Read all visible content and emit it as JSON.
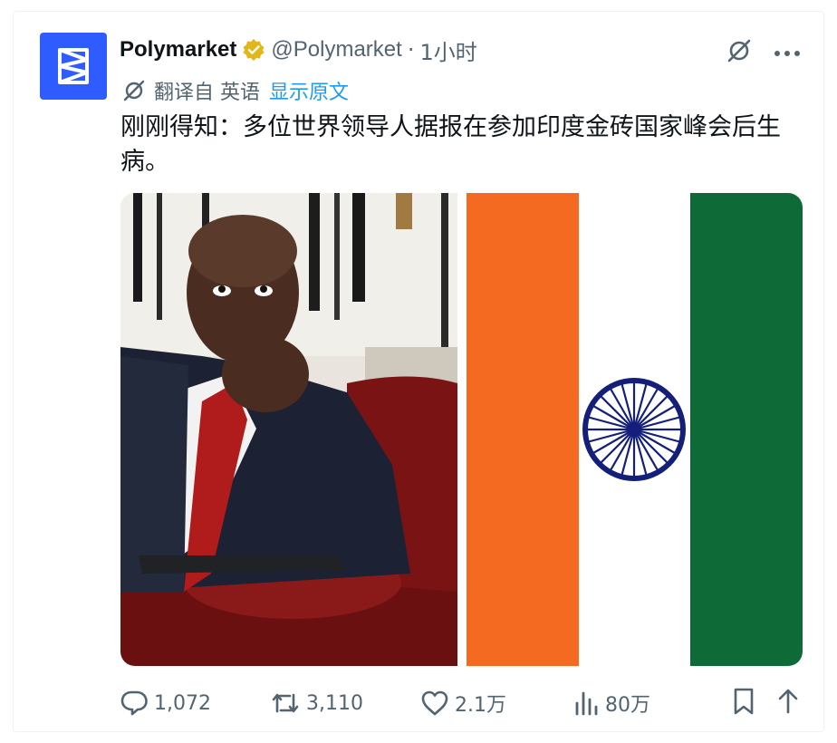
{
  "post": {
    "author": {
      "display_name": "Polymarket",
      "handle": "@Polymarket",
      "verified": true,
      "avatar_color": "#2e5cff"
    },
    "separator": "·",
    "time": "1小时",
    "translation": {
      "label": "翻译自 英语",
      "show_original": "显示原文"
    },
    "text": "刚刚得知：多位世界领导人据报在参加印度金砖国家峰会后生病。",
    "media": {
      "flag_colors": {
        "saffron": "#f56a21",
        "white": "#ffffff",
        "green": "#0e6a37",
        "chakra": "#141f7a"
      }
    },
    "stats": {
      "replies": "1,072",
      "reposts": "3,110",
      "likes": "2.1万",
      "views": "80万"
    },
    "icons": [
      "grok-icon",
      "more-icon",
      "translate-icon",
      "reply-icon",
      "repost-icon",
      "like-icon",
      "views-icon",
      "bookmark-icon",
      "share-icon",
      "verified-badge-icon"
    ]
  }
}
